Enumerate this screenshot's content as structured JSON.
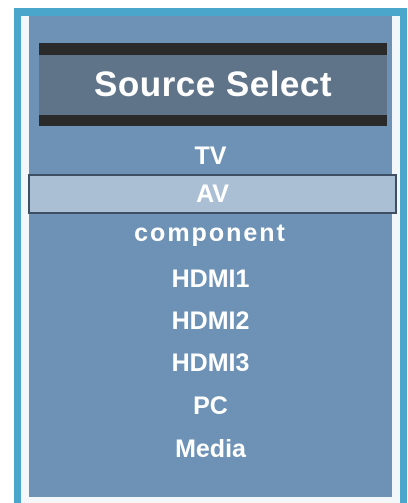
{
  "dialog": {
    "title": "Source Select",
    "selected_index": 1,
    "items": [
      {
        "label": "TV"
      },
      {
        "label": "AV"
      },
      {
        "label": "component"
      },
      {
        "label": "HDMI1"
      },
      {
        "label": "HDMI2"
      },
      {
        "label": "HDMI3"
      },
      {
        "label": "PC"
      },
      {
        "label": "Media"
      }
    ]
  },
  "colors": {
    "frame": "#4ba6cc",
    "panel": "#6d92b6",
    "title_bar": "#5f7389",
    "title_band": "#2a2a2a",
    "highlight": "#aabfd3",
    "text": "#ffffff"
  }
}
